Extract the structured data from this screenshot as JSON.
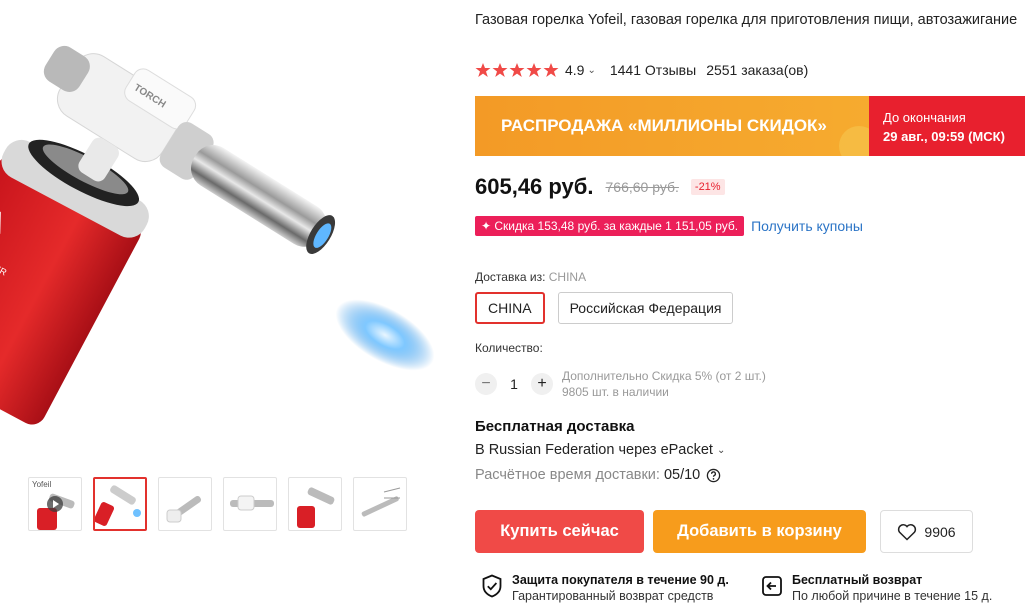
{
  "product": {
    "title": "Газовая горелка Yofeil, газовая горелка для приготовления пищи, автозажигание",
    "rating": "4.9",
    "reviews": "1441 Отзывы",
    "orders": "2551 заказа(ов)"
  },
  "gallery": {
    "main_label": "TORCH",
    "can_label": "DANGER",
    "thumb_brand": "Yofeil",
    "active_index": 1
  },
  "sale": {
    "banner_text": "РАСПРОДАЖА «МИЛЛИОНЫ СКИДОК»",
    "until_label": "До окончания",
    "until_date": "29 авг., 09:59 (МСК)",
    "left_color": "#F39A26",
    "right_color": "#E8202E"
  },
  "price": {
    "current": "605,46 руб.",
    "old": "766,60 руб.",
    "discount": "-21%"
  },
  "coupon": {
    "badge": "✦ Скидка 153,48 руб. за каждые 1 151,05 руб.",
    "link": "Получить купоны"
  },
  "shipping_from": {
    "label": "Доставка из:",
    "value": "CHINA",
    "options": [
      "CHINA",
      "Российская Федерация"
    ],
    "selected": "CHINA"
  },
  "quantity": {
    "label": "Количество:",
    "minus": "−",
    "value": "1",
    "plus": "+",
    "note_line1": "Дополнительно Скидка 5% (от 2 шт.)",
    "note_line2": "9805 шт. в наличии"
  },
  "delivery": {
    "title": "Бесплатная доставка",
    "method": "В Russian Federation через ePacket",
    "time_label": "Расчётное время доставки:",
    "time_value": "05/10"
  },
  "actions": {
    "buy": "Купить сейчас",
    "cart": "Добавить в корзину",
    "wishlist_count": "9906",
    "buy_color": "#F04A47",
    "cart_color": "#F79C1C"
  },
  "guarantees": [
    {
      "title": "Защита покупателя в течение 90 д.",
      "subtitle": "Гарантированный возврат средств",
      "icon": "shield-check-icon"
    },
    {
      "title": "Бесплатный возврат",
      "subtitle": "По любой причине в течение 15 д.",
      "icon": "return-icon"
    }
  ]
}
